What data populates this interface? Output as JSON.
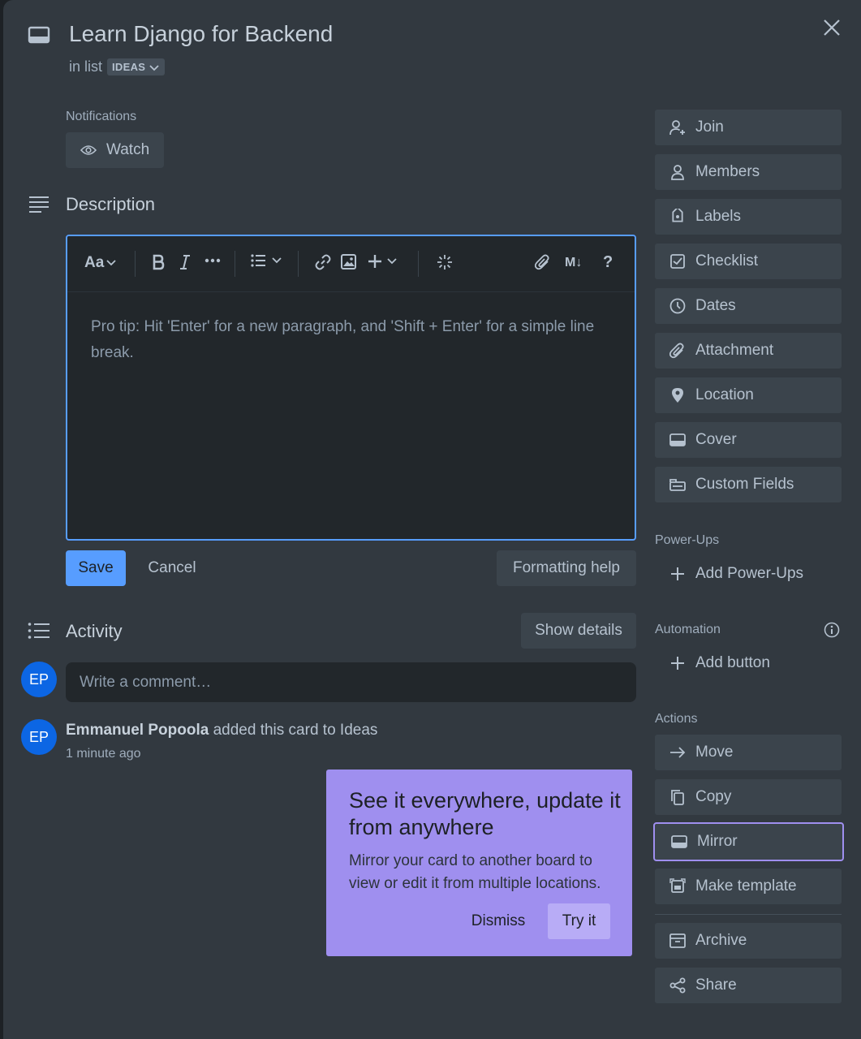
{
  "card": {
    "title": "Learn Django for Backend",
    "in_list_prefix": "in list",
    "list_name": "IDEAS"
  },
  "notifications": {
    "label": "Notifications",
    "watch_label": "Watch"
  },
  "description": {
    "heading": "Description",
    "placeholder": "Pro tip: Hit 'Enter' for a new paragraph, and 'Shift + Enter' for a simple line break.",
    "toolbar": {
      "text_style": "Aa",
      "markdown": "M↓",
      "help": "?"
    },
    "save_label": "Save",
    "cancel_label": "Cancel",
    "formatting_help_label": "Formatting help"
  },
  "activity": {
    "heading": "Activity",
    "show_details_label": "Show details",
    "comment_placeholder": "Write a comment…",
    "user_initials": "EP",
    "entries": [
      {
        "initials": "EP",
        "user": "Emmanuel Popoola",
        "action": "added this card to Ideas",
        "time": "1 minute ago"
      }
    ]
  },
  "popup": {
    "title": "See it everywhere, update it from anywhere",
    "body": "Mirror your card to another board to view or edit it from multiple locations.",
    "dismiss_label": "Dismiss",
    "try_label": "Try it"
  },
  "sidebar": {
    "buttons": [
      {
        "label": "Join",
        "icon": "add-person-icon"
      },
      {
        "label": "Members",
        "icon": "person-icon"
      },
      {
        "label": "Labels",
        "icon": "tag-icon"
      },
      {
        "label": "Checklist",
        "icon": "checkbox-icon"
      },
      {
        "label": "Dates",
        "icon": "clock-icon"
      },
      {
        "label": "Attachment",
        "icon": "paperclip-icon"
      },
      {
        "label": "Location",
        "icon": "pin-icon"
      },
      {
        "label": "Cover",
        "icon": "card-icon"
      },
      {
        "label": "Custom Fields",
        "icon": "fields-icon"
      }
    ],
    "powerups": {
      "label": "Power-Ups",
      "add_label": "Add Power-Ups"
    },
    "automation": {
      "label": "Automation",
      "add_label": "Add button"
    },
    "actions": {
      "label": "Actions",
      "buttons": [
        {
          "label": "Move",
          "icon": "arrow-right-icon"
        },
        {
          "label": "Copy",
          "icon": "copy-icon"
        },
        {
          "label": "Mirror",
          "icon": "card-icon"
        },
        {
          "label": "Make template",
          "icon": "template-icon"
        },
        {
          "label": "Archive",
          "icon": "archive-icon"
        },
        {
          "label": "Share",
          "icon": "share-icon"
        }
      ]
    }
  }
}
